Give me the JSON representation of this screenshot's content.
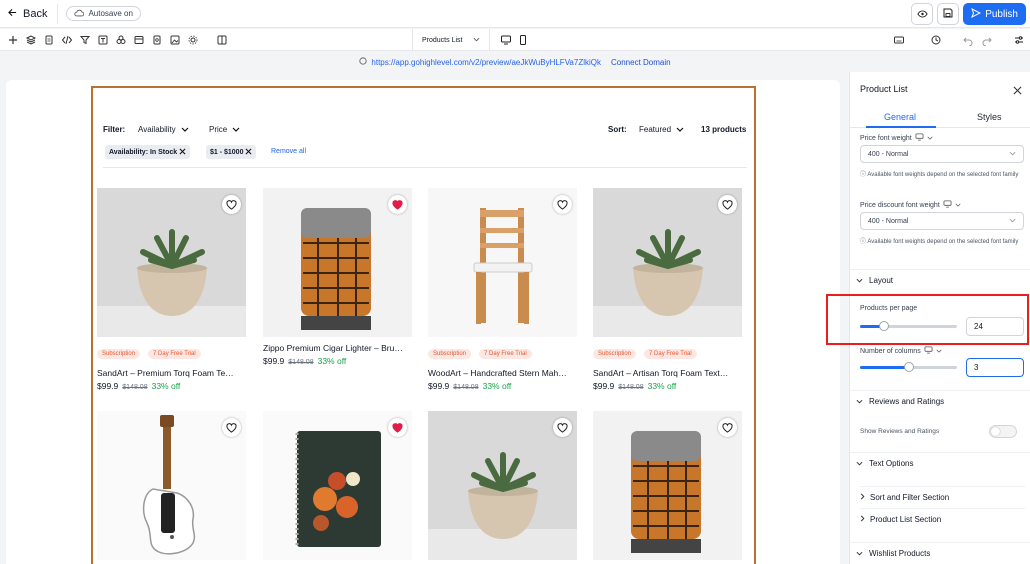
{
  "topbar": {
    "back_label": "Back",
    "autosave_label": "Autosave on",
    "publish_label": "Publish"
  },
  "toolbar": {
    "page_selector_value": "Products List"
  },
  "urlbar": {
    "url": "https://app.gohighlevel.com/v2/preview/aeJkWuByHLFVa7ZlkiQk",
    "connect_label": "Connect Domain"
  },
  "store": {
    "filter_label": "Filter:",
    "filters": [
      {
        "label": "Availability"
      },
      {
        "label": "Price"
      }
    ],
    "sort_label": "Sort:",
    "sort_value": "Featured",
    "product_count": "13 products",
    "active_filters": [
      "Availability: In Stock",
      "$1 - $1000"
    ],
    "remove_all_label": "Remove all",
    "products": [
      {
        "name": "SandArt – Premium Torq Foam Te…",
        "price": "$99.9",
        "compare_price": "$148.08",
        "discount": "33% off",
        "tags": [
          "Subscription",
          "7 Day Free Trial"
        ],
        "favorited": false,
        "image": "succulent"
      },
      {
        "name": "Zippo Premium Cigar Lighter – Bru…",
        "price": "$99.9",
        "compare_price": "$148.08",
        "discount": "33% off",
        "tags": [],
        "favorited": true,
        "image": "lighter"
      },
      {
        "name": "WoodArt – Handcrafted Stern Mah…",
        "price": "$99.9",
        "compare_price": "$148.08",
        "discount": "33% off",
        "tags": [
          "Subscription",
          "7 Day Free Trial"
        ],
        "favorited": false,
        "image": "chair"
      },
      {
        "name": "SandArt – Artisan Torq Foam Text…",
        "price": "$99.9",
        "compare_price": "$148.08",
        "discount": "33% off",
        "tags": [
          "Subscription",
          "7 Day Free Trial"
        ],
        "favorited": false,
        "image": "succulent"
      },
      {
        "favorited": false,
        "image": "guitar"
      },
      {
        "favorited": true,
        "image": "notebook"
      },
      {
        "favorited": false,
        "image": "succulent"
      },
      {
        "favorited": false,
        "image": "lighter"
      }
    ]
  },
  "panel": {
    "title": "Product List",
    "tabs": [
      "General",
      "Styles"
    ],
    "price_font_weight_label": "Price font weight",
    "price_font_weight_value": "400 - Normal",
    "hint": "Available font weights depend on the selected font family",
    "price_discount_font_weight_label": "Price discount font weight",
    "price_discount_font_weight_value": "400 - Normal",
    "layout_label": "Layout",
    "products_per_page_label": "Products per page",
    "products_per_page_value": "24",
    "products_per_page_level": 0.25,
    "columns_label": "Number of columns",
    "columns_value": "3",
    "columns_level": 0.5,
    "reviews_label": "Reviews and Ratings",
    "show_reviews_label": "Show Reviews and Ratings",
    "show_reviews_on": false,
    "text_options_label": "Text Options",
    "text_subsections": [
      "Sort and Filter Section",
      "Product List Section"
    ],
    "wishlist_label": "Wishlist Products"
  },
  "colors": {
    "accent": "#1d6cf2",
    "highlight": "#ee1c1c",
    "discount": "#16a34a",
    "tag_text": "#e4572e",
    "frame": "#b87333"
  }
}
